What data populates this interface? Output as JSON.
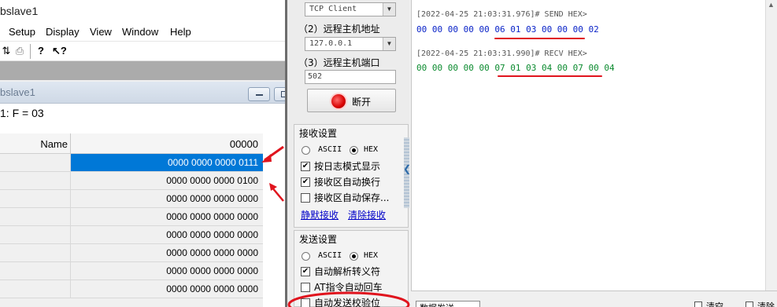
{
  "left_window": {
    "title": "bslave1",
    "menu": [
      "Setup",
      "Display",
      "View",
      "Window",
      "Help"
    ],
    "toolbar_icons": [
      "print-icon",
      "help-icon",
      "context-help-icon"
    ],
    "child_window": {
      "title": "bslave1",
      "id_line": "1: F = 03",
      "columns": [
        "Name",
        "00000"
      ],
      "rows": [
        {
          "name": "",
          "value": "0000 0000 0000 0111",
          "selected": true
        },
        {
          "name": "",
          "value": "0000 0000 0000 0100",
          "selected": false
        },
        {
          "name": "",
          "value": "0000 0000 0000 0000",
          "selected": false
        },
        {
          "name": "",
          "value": "0000 0000 0000 0000",
          "selected": false
        },
        {
          "name": "",
          "value": "0000 0000 0000 0000",
          "selected": false
        },
        {
          "name": "",
          "value": "0000 0000 0000 0000",
          "selected": false
        },
        {
          "name": "",
          "value": "0000 0000 0000 0000",
          "selected": false
        },
        {
          "name": "",
          "value": "0000 0000 0000 0000",
          "selected": false
        }
      ]
    }
  },
  "settings": {
    "protocol": "TCP Client",
    "host_label": "（2）远程主机地址",
    "host_value": "127.0.0.1",
    "port_label": "（3）远程主机端口",
    "port_value": "502",
    "disconnect_label": "断开",
    "receive": {
      "title": "接收设置",
      "ascii": "ASCII",
      "hex": "HEX",
      "hex_selected": true,
      "options": [
        {
          "label": "按日志模式显示",
          "checked": true
        },
        {
          "label": "接收区自动换行",
          "checked": true
        },
        {
          "label": "接收区自动保存...",
          "checked": false
        }
      ],
      "links": [
        "静默接收",
        "清除接收"
      ]
    },
    "send": {
      "title": "发送设置",
      "ascii": "ASCII",
      "hex": "HEX",
      "hex_selected": true,
      "options": [
        {
          "label": "自动解析转义符",
          "checked": true
        },
        {
          "label": "AT指令自动回车",
          "checked": false
        },
        {
          "label": "自动发送校验位",
          "checked": false
        }
      ]
    }
  },
  "log": [
    {
      "header": "[2022-04-25 21:03:31.976]# SEND HEX>",
      "hex": "00 00 00 00 00 06 01 03 00 00 00 02",
      "color": "#0b24c8"
    },
    {
      "header": "[2022-04-25 21:03:31.990]# RECV HEX>",
      "hex": "00 00 00 00 00 07 01 03 04 00 07 00 04",
      "color": "#0a8a2e"
    }
  ],
  "bottom_bar": {
    "tab_label": "数据发送",
    "opt1": "清空",
    "opt2": "清除"
  },
  "colors": {
    "selection": "#0078d7",
    "annotation": "#e0141e"
  }
}
